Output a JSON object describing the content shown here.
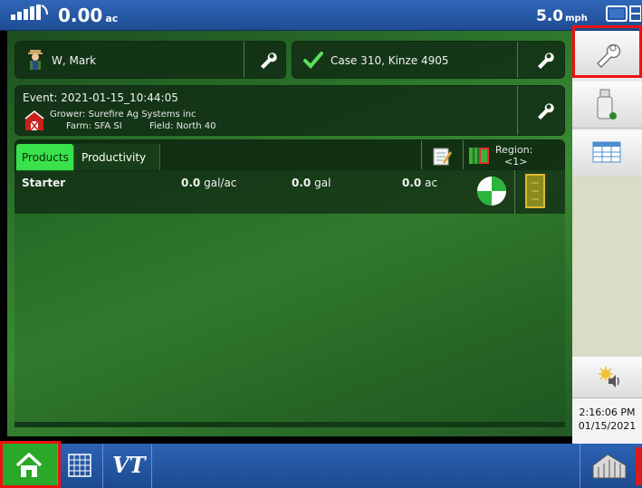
{
  "status": {
    "area_value": "0.00",
    "area_unit": "ac",
    "speed_value": "5.0",
    "speed_unit": "mph"
  },
  "operator": {
    "name": "W, Mark"
  },
  "equipment": {
    "name": "Case 310, Kinze 4905"
  },
  "event": {
    "title": "Event: 2021-01-15_10:44:05",
    "grower": "Grower: Surefire Ag Systems inc",
    "farm": "Farm: SFA SI",
    "field": "Field: North 40"
  },
  "tabs": {
    "products": "Products",
    "productivity": "Productivity"
  },
  "region": {
    "label": "Region:",
    "value": "<1>"
  },
  "product": {
    "name": "Starter",
    "rate_value": "0.0",
    "rate_unit": "gal/ac",
    "volume_value": "0.0",
    "volume_unit": "gal",
    "area_value": "0.0",
    "area_unit": "ac"
  },
  "clock": {
    "time": "2:16:06 PM",
    "date": "01/15/2021"
  },
  "bottom": {
    "vt_label": "VT"
  },
  "colors": {
    "accent_green": "#39e14a",
    "highlight_red": "#e11111",
    "bar_blue": "#2d63b4"
  },
  "icons": {
    "gps": "gps-signal-icon",
    "display": "display-icon",
    "operator": "farmer-icon",
    "check": "checkmark-icon",
    "wrench": "wrench-icon",
    "barn": "barn-icon",
    "notes": "notepad-icon",
    "region": "region-map-icon",
    "pie": "coverage-pie-icon",
    "tank": "tank-level-icon",
    "usb": "usb-drive-icon",
    "table": "table-icon",
    "volume": "speaker-icon",
    "home": "home-icon",
    "grid": "grid-icon",
    "vt": "vt-icon",
    "truck": "semi-truck-icon"
  }
}
